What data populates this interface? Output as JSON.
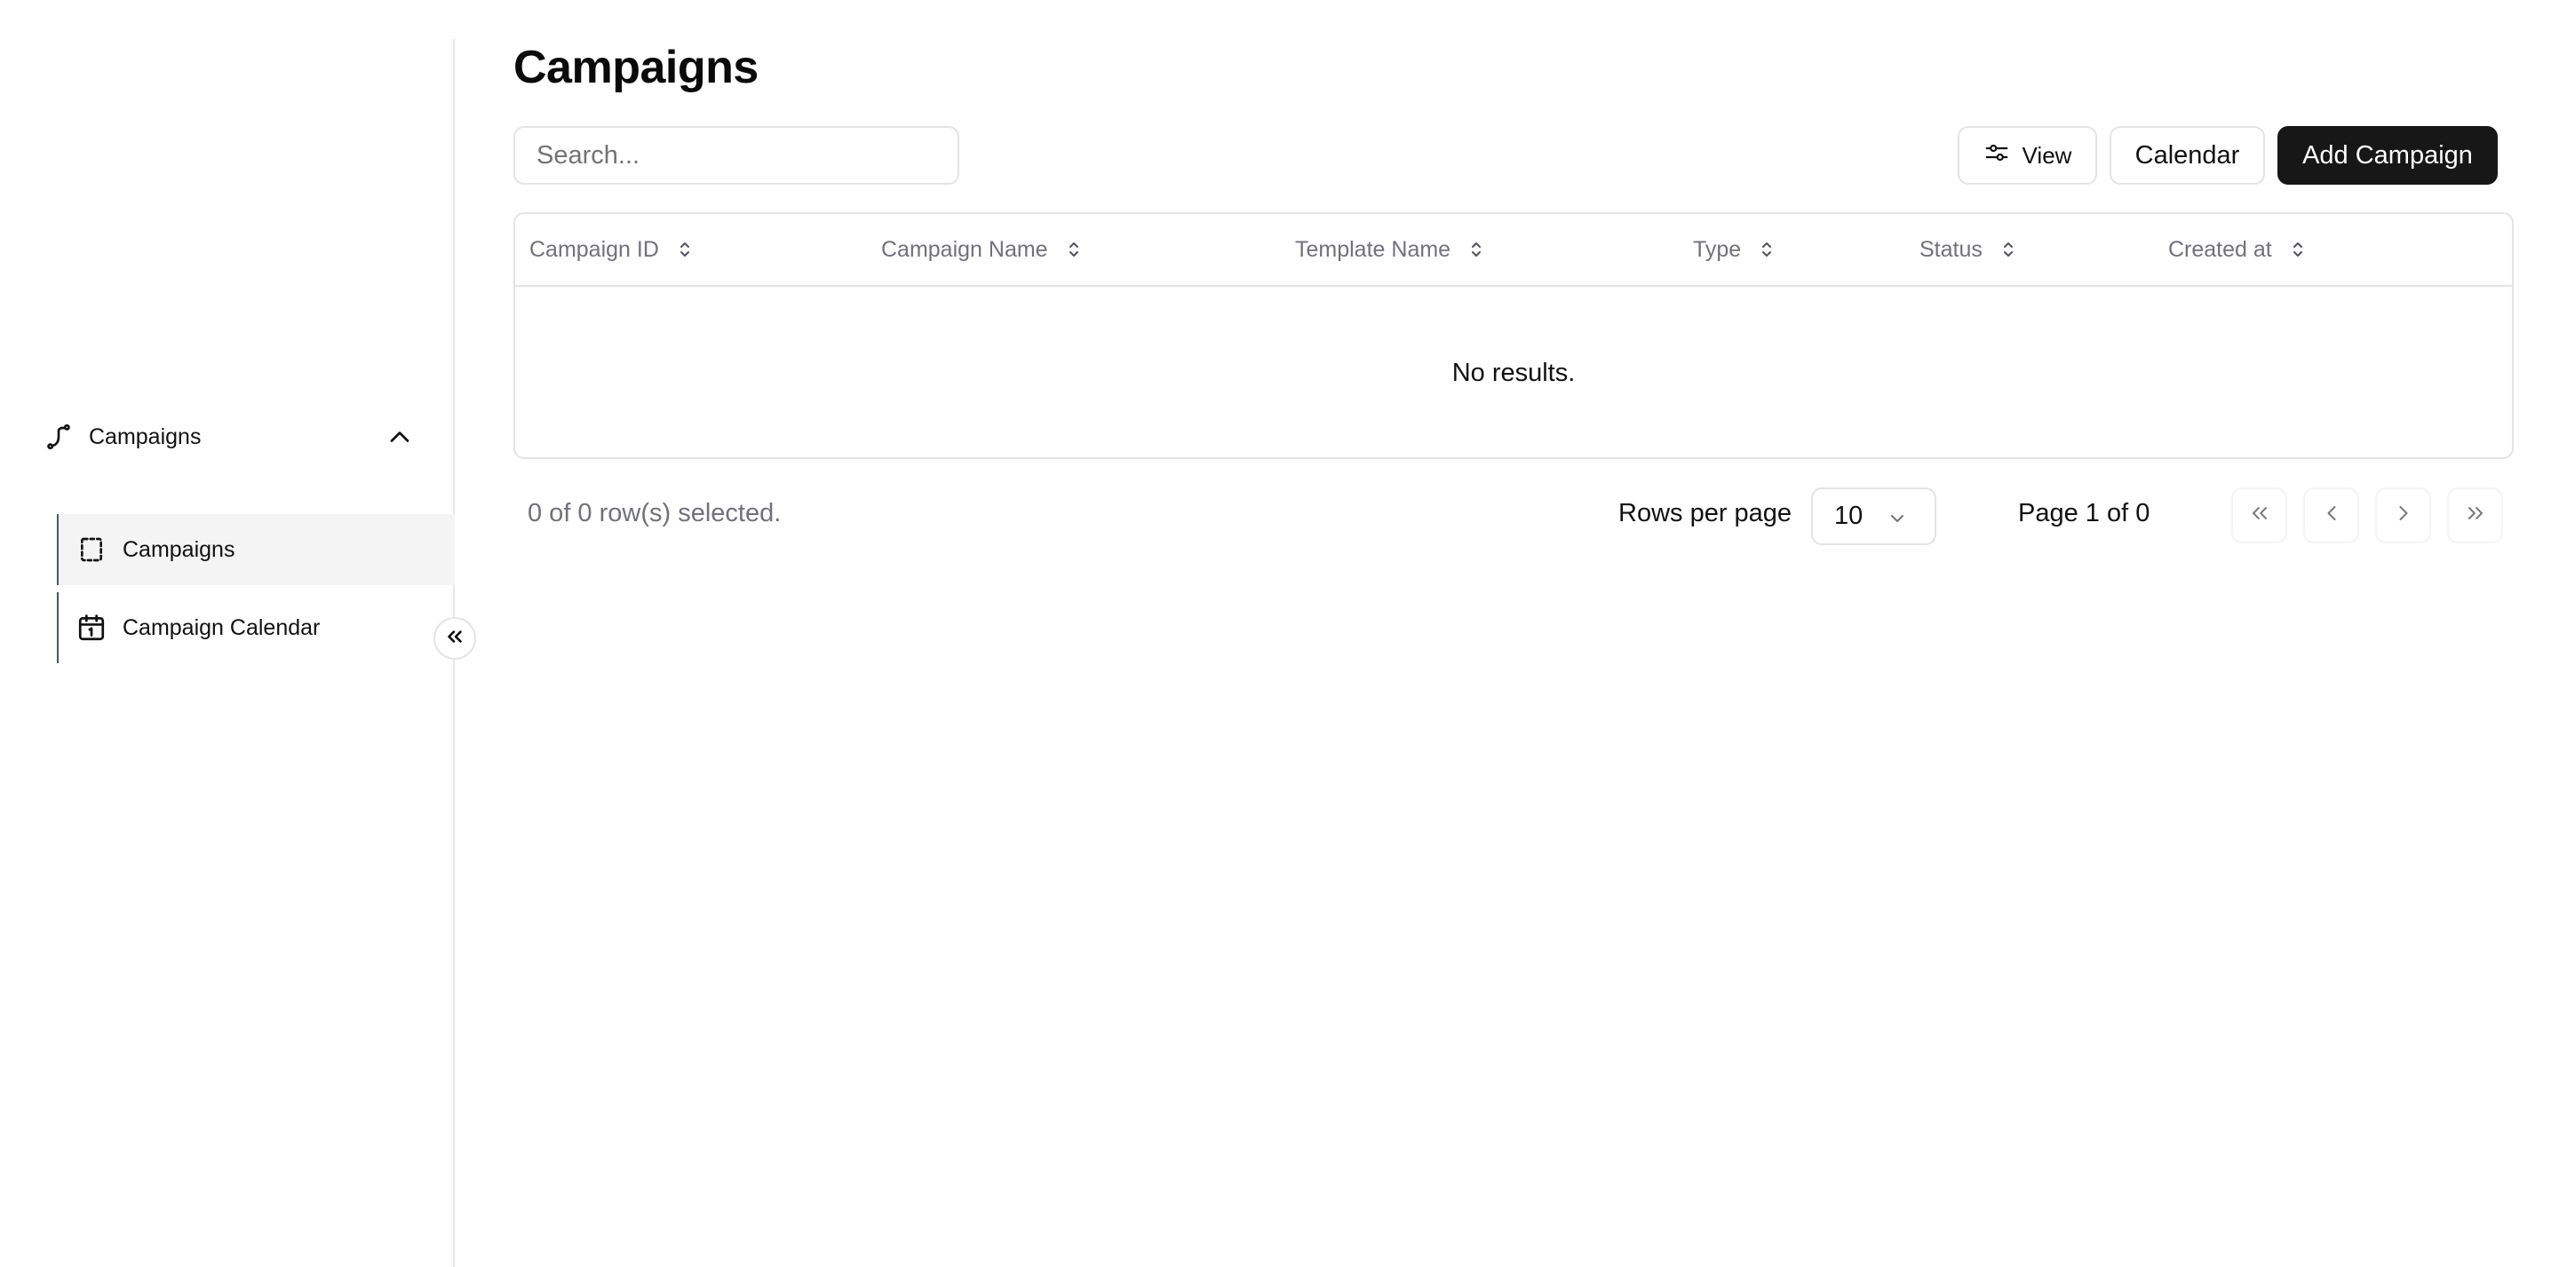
{
  "sidebar": {
    "group": {
      "label": "Campaigns",
      "icon": "route-icon",
      "expanded": true
    },
    "items": [
      {
        "label": "Campaigns",
        "icon": "dashed-square-icon",
        "active": true
      },
      {
        "label": "Campaign Calendar",
        "icon": "calendar-icon",
        "active": false
      }
    ],
    "collapse_icon": "chevrons-left-icon"
  },
  "main": {
    "title": "Campaigns",
    "search": {
      "placeholder": "Search...",
      "value": ""
    },
    "toolbar": {
      "view_label": "View",
      "calendar_label": "Calendar",
      "add_label": "Add Campaign"
    },
    "table": {
      "columns": [
        "Campaign ID",
        "Campaign Name",
        "Template Name",
        "Type",
        "Status",
        "Created at"
      ],
      "rows": [],
      "empty_text": "No results."
    },
    "footer": {
      "selected_text": "0 of 0 row(s) selected.",
      "rows_per_page_label": "Rows per page",
      "rows_per_page_value": "10",
      "page_info": "Page 1 of 0"
    }
  },
  "colors": {
    "primary": "#171717",
    "border": "#e4e4e7",
    "muted_text": "#71717a",
    "active_bg": "#f4f4f5"
  }
}
